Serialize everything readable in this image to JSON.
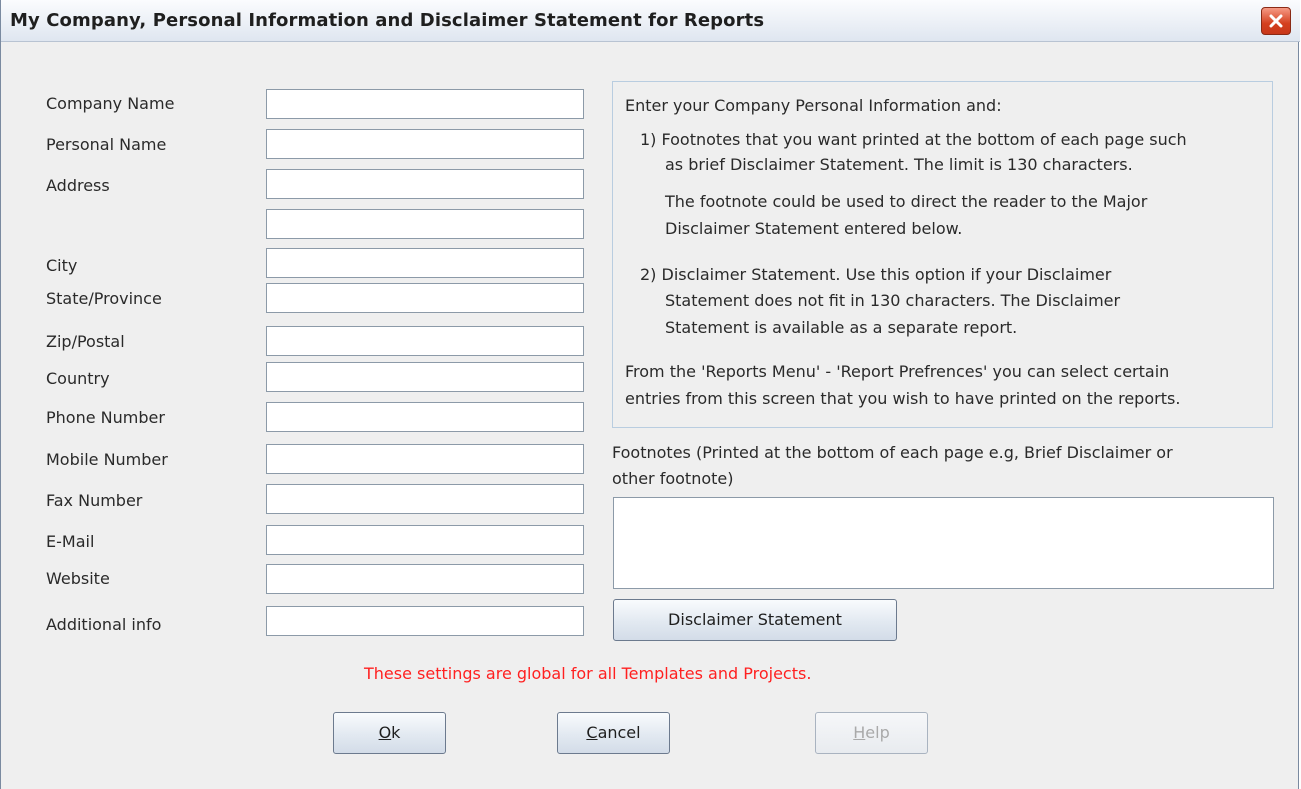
{
  "window": {
    "title": "My Company, Personal Information and Disclaimer Statement for Reports"
  },
  "form": {
    "labels": {
      "company_name": "Company Name",
      "personal_name": "Personal Name",
      "address": "Address",
      "city": "City",
      "state": "State/Province",
      "zip": "Zip/Postal",
      "country": "Country",
      "phone": "Phone Number",
      "mobile": "Mobile Number",
      "fax": "Fax Number",
      "email": "E-Mail",
      "website": "Website",
      "additional": "Additional info"
    },
    "values": {
      "company_name": "",
      "personal_name": "",
      "address1": "",
      "address2": "",
      "city": "",
      "state": "",
      "zip": "",
      "country": "",
      "phone": "",
      "mobile": "",
      "fax": "",
      "email": "",
      "website": "",
      "additional": ""
    }
  },
  "info": {
    "intro": "Enter your Company  Personal Information and:",
    "item1_line1": "1) Footnotes that you want printed at the bottom of each page such",
    "item1_line2": "as brief Disclaimer Statement. The limit is 130 characters.",
    "item1_note1": "The footnote could be used to direct the reader to the Major",
    "item1_note2": "Disclaimer Statement entered below.",
    "item2_line1": "2) Disclaimer Statement. Use this option if your Disclaimer",
    "item2_line2": "Statement does not fit in 130 characters. The Disclaimer",
    "item2_line3": "Statement is available as a separate report.",
    "footer_line1": "From the 'Reports Menu' - 'Report Prefrences' you can select certain",
    "footer_line2": "entries from this screen that you wish to have printed on the reports."
  },
  "footnotes": {
    "label_line1": "Footnotes (Printed at the bottom of each page e.g, Brief Disclaimer or",
    "label_line2": "other footnote)",
    "value": ""
  },
  "buttons": {
    "disclaimer": "Disclaimer Statement",
    "ok_mnemonic": "O",
    "ok_rest": "k",
    "cancel_mnemonic": "C",
    "cancel_rest": "ancel",
    "help_mnemonic": "H",
    "help_rest": "elp"
  },
  "note": "These settings are global for all Templates and Projects.",
  "colors": {
    "note_color": "#ff2020",
    "close_button": "#d4401f"
  },
  "icons": {
    "close": "close-icon"
  }
}
